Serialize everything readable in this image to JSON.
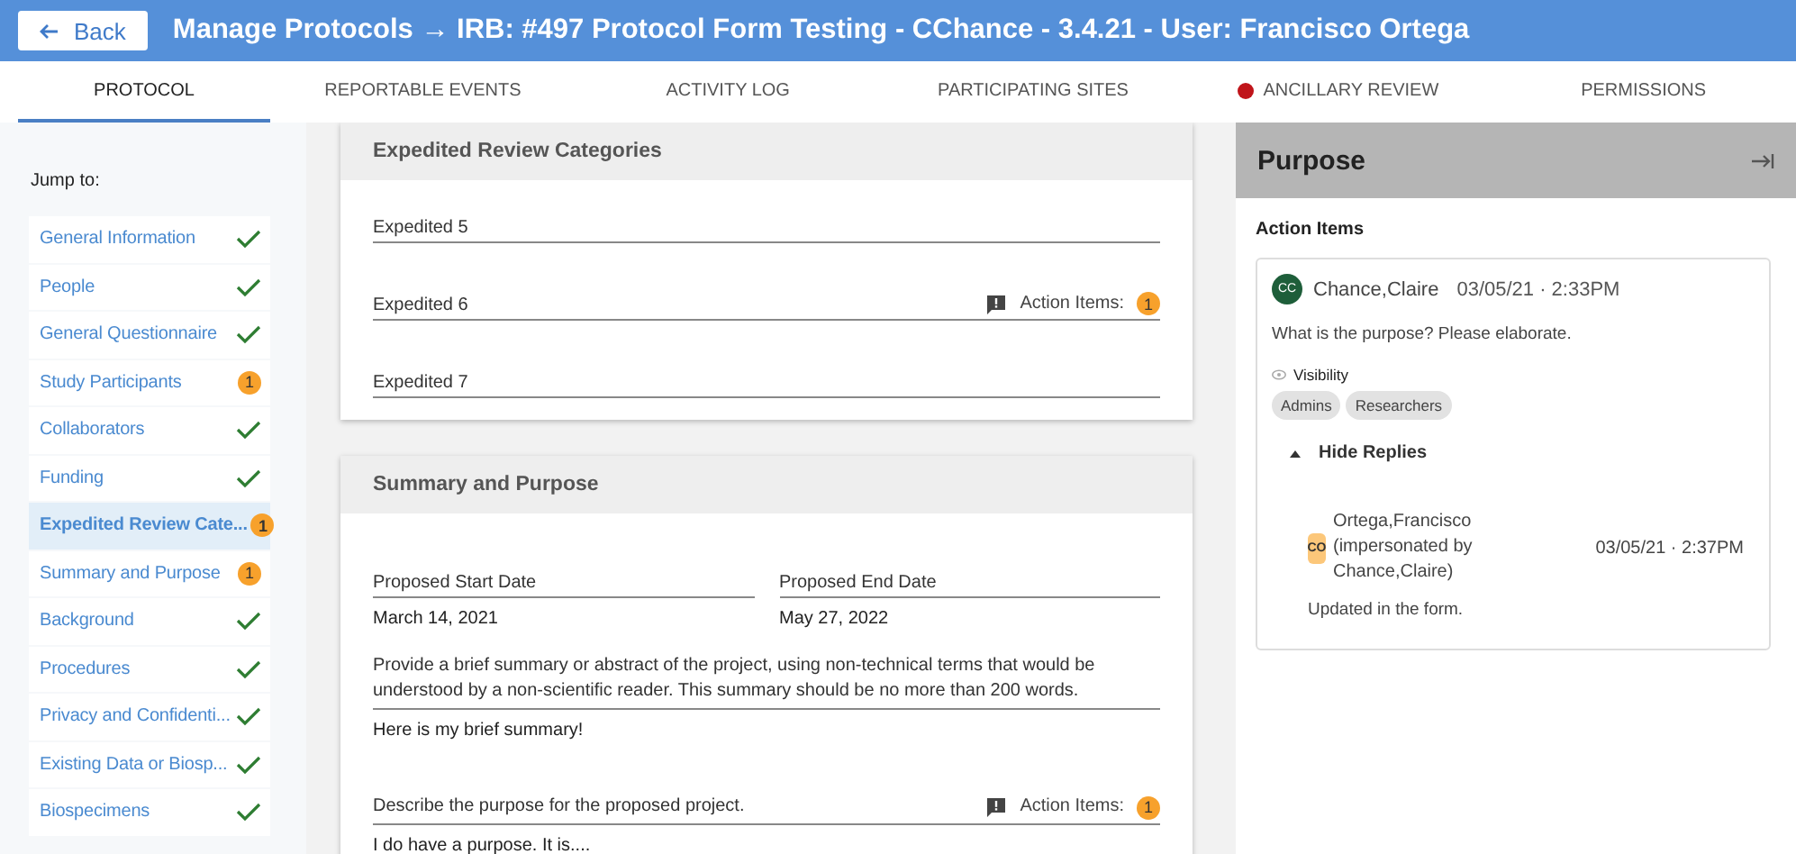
{
  "header": {
    "back_label": "Back",
    "title": "Manage Protocols → IRB: #497 Protocol Form Testing - CChance - 3.4.21 - User: Francisco Ortega"
  },
  "tabs": [
    {
      "label": "PROTOCOL",
      "selected": true,
      "alert": false
    },
    {
      "label": "REPORTABLE EVENTS",
      "selected": false,
      "alert": false
    },
    {
      "label": "ACTIVITY LOG",
      "selected": false,
      "alert": false
    },
    {
      "label": "PARTICIPATING SITES",
      "selected": false,
      "alert": false
    },
    {
      "label": "ANCILLARY REVIEW",
      "selected": false,
      "alert": true
    },
    {
      "label": "PERMISSIONS",
      "selected": false,
      "alert": false
    }
  ],
  "sidebar": {
    "heading": "Jump to:",
    "items": [
      {
        "label": "General Information",
        "selected": false,
        "kind": "check"
      },
      {
        "label": "People",
        "selected": false,
        "kind": "check"
      },
      {
        "label": "General Questionnaire",
        "selected": false,
        "kind": "check"
      },
      {
        "label": "Study Participants",
        "selected": false,
        "kind": "badge",
        "count": "1"
      },
      {
        "label": "Collaborators",
        "selected": false,
        "kind": "check"
      },
      {
        "label": "Funding",
        "selected": false,
        "kind": "check"
      },
      {
        "label": "Expedited Review Cate...",
        "selected": true,
        "kind": "badge",
        "count": "1"
      },
      {
        "label": "Summary and Purpose",
        "selected": false,
        "kind": "badge",
        "count": "1"
      },
      {
        "label": "Background",
        "selected": false,
        "kind": "check"
      },
      {
        "label": "Procedures",
        "selected": false,
        "kind": "check"
      },
      {
        "label": "Privacy and Confidenti...",
        "selected": false,
        "kind": "check"
      },
      {
        "label": "Existing Data or Biosp...",
        "selected": false,
        "kind": "check"
      },
      {
        "label": "Biospecimens",
        "selected": false,
        "kind": "check"
      }
    ]
  },
  "cards": [
    {
      "title": "Expedited Review Categories",
      "fields": [
        {
          "kind": "line",
          "label": "Expedited 5"
        },
        {
          "kind": "line",
          "label": "Expedited 6",
          "action_items": {
            "label": "Action Items:",
            "count": "1"
          }
        },
        {
          "kind": "line",
          "label": "Expedited 7"
        }
      ]
    },
    {
      "title": "Summary and Purpose",
      "fields": [
        {
          "kind": "dates",
          "columns": [
            {
              "label": "Proposed Start Date",
              "value": "March 14, 2021"
            },
            {
              "label": "Proposed End Date",
              "value": "May 27, 2022"
            }
          ]
        },
        {
          "kind": "question",
          "label": "Provide a brief summary or abstract of the project, using non-technical terms that would be understood by a non-scientific reader. This summary should be no more than 200 words.",
          "value": "Here is my brief summary!"
        },
        {
          "kind": "question",
          "label": "Describe the purpose for the proposed project.",
          "value": "I do have a purpose.  It is....",
          "action_items": {
            "label": "Action Items:",
            "count": "1"
          }
        }
      ]
    }
  ],
  "panel": {
    "title": "Purpose",
    "heading": "Action Items",
    "comment": {
      "initials": "CC",
      "color": "#1e5e3a",
      "author": "Chance,Claire",
      "time": "03/05/21 · 2:33PM",
      "message": "What is the purpose? Please elaborate.",
      "visibility_label": "Visibility",
      "chips": [
        "Admins",
        "Researchers"
      ],
      "replies_toggle": "Hide Replies",
      "reply": {
        "initials": "CO",
        "color": "#fcc77a",
        "author": "Ortega,Francisco (impersonated by Chance,Claire)",
        "time": "03/05/21 · 2:37PM",
        "message": "Updated in the form."
      }
    }
  }
}
